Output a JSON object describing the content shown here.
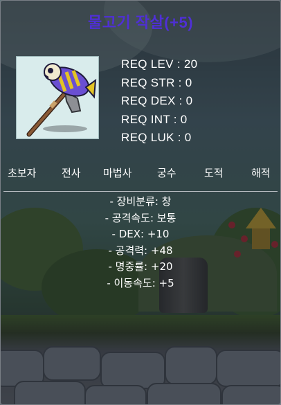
{
  "item": {
    "name": "물고기 작살(+5)",
    "icon": "fish-harpoon-icon"
  },
  "requirements": [
    "REQ LEV : 20",
    "REQ STR : 0",
    "REQ DEX : 0",
    "REQ INT : 0",
    "REQ LUK : 0"
  ],
  "jobs": [
    "초보자",
    "전사",
    "마법사",
    "궁수",
    "도적",
    "해적"
  ],
  "stats": [
    "- 장비분류: 창",
    "- 공격속도: 보통",
    "- DEX: +10",
    "- 공격력: +48",
    "- 명중률: +20",
    "- 이동속도: +5"
  ],
  "colors": {
    "title": "#4f2fd6",
    "text": "#ffffff",
    "icon_bg": "#d9ecec"
  }
}
